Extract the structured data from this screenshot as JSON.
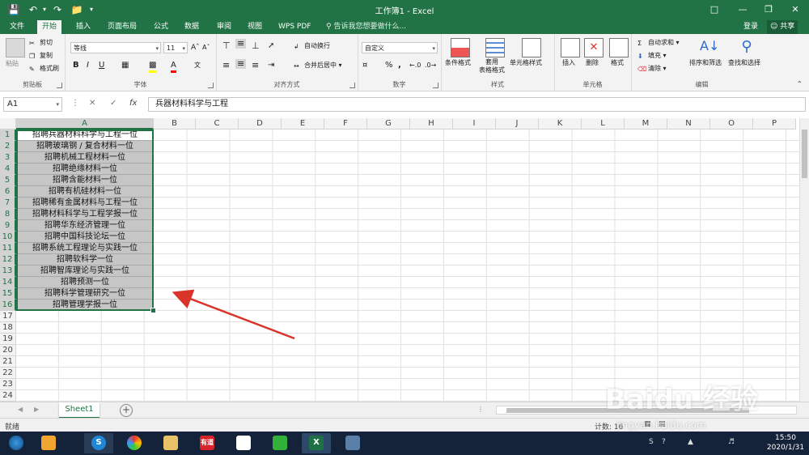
{
  "window": {
    "title": "工作簿1 - Excel"
  },
  "tabs": [
    "文件",
    "开始",
    "插入",
    "页面布局",
    "公式",
    "数据",
    "审阅",
    "视图",
    "WPS PDF"
  ],
  "active_tab": "开始",
  "tell_me": "告诉我您想要做什么...",
  "login": "登录",
  "share": "共享",
  "ribbon": {
    "clipboard": {
      "paste": "粘贴",
      "cut": "剪切",
      "copy": "复制",
      "format_painter": "格式刷",
      "label": "剪贴板"
    },
    "font": {
      "name": "等线",
      "size": "11",
      "bold": "B",
      "italic": "I",
      "underline": "U",
      "label": "字体"
    },
    "alignment": {
      "wrap": "自动换行",
      "merge": "合并后居中",
      "label": "对齐方式"
    },
    "number": {
      "format": "自定义",
      "percent": "%",
      "comma": ",",
      "label": "数字"
    },
    "styles": {
      "conditional": "条件格式",
      "table": "套用\n表格格式",
      "cell_styles": "单元格样式",
      "label": "样式"
    },
    "cells": {
      "insert": "插入",
      "delete": "删除",
      "format": "格式",
      "label": "单元格"
    },
    "editing": {
      "autosum": "自动求和",
      "fill": "填充",
      "clear": "清除",
      "sort": "排序和筛选",
      "find": "查找和选择",
      "label": "编辑"
    }
  },
  "name_box": "A1",
  "formula": "兵器材料科学与工程",
  "columns": [
    "A",
    "B",
    "C",
    "D",
    "E",
    "F",
    "G",
    "H",
    "I",
    "J",
    "K",
    "L",
    "M",
    "N",
    "O",
    "P"
  ],
  "rows": [
    "1",
    "2",
    "3",
    "4",
    "5",
    "6",
    "7",
    "8",
    "9",
    "10",
    "11",
    "12",
    "13",
    "14",
    "15",
    "16",
    "17",
    "18",
    "19",
    "20",
    "21",
    "22",
    "23",
    "24"
  ],
  "cells_A": [
    "招聘兵器材料科学与工程一位",
    "招聘玻璃钢 / 复合材料一位",
    "招聘机械工程材料一位",
    "招聘绝缘材料一位",
    "招聘含能材料一位",
    "招聘有机硅材料一位",
    "招聘稀有金属材料与工程一位",
    "招聘材料科学与工程学报一位",
    "招聘华东经济管理一位",
    "招聘中国科技论坛一位",
    "招聘系统工程理论与实践一位",
    "招聘软科学一位",
    "招聘智库理论与实践一位",
    "招聘预测一位",
    "招聘科学管理研究一位",
    "招聘管理学报一位"
  ],
  "sheet_tab": "Sheet1",
  "status": "就绪",
  "count": "计数: 16",
  "clock": {
    "time": "15:50",
    "date": "2020/1/31"
  },
  "watermark": {
    "main": "Baidu 经验",
    "sub": "jingyan.baidu.com"
  },
  "colors": {
    "excel_green": "#217346",
    "selection": "#c6c6c6",
    "arrow": "#d9332a"
  }
}
